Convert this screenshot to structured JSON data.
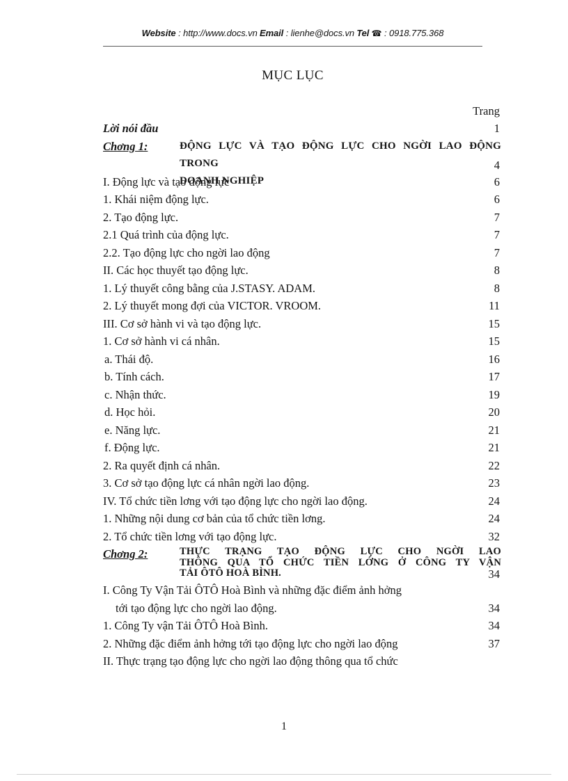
{
  "header": {
    "website_label": "Website",
    "website_sep": " : ",
    "website_value": "http://www.docs.vn",
    "email_label": "Email",
    "email_sep": "  : ",
    "email_value": "lienhe@docs.vn",
    "tel_label": "Tel",
    "tel_glyph": "☎",
    "tel_sep": " : ",
    "tel_value": "0918.775.368"
  },
  "title": "MỤC LỤC",
  "column_header": {
    "label": "",
    "page_label": "Trang"
  },
  "entries": [
    {
      "kind": "front",
      "label": "Lời nói đầu",
      "page": "1"
    },
    {
      "kind": "chapter",
      "tag": "Chơng  1:",
      "lines": [
        "ĐỘNG LỰC VÀ TẠO ĐỘNG LỰC CHO NGỜI    LAO ĐỘNG TRONG",
        "DOANH NGHIỆP"
      ],
      "page": "4"
    },
    {
      "kind": "item",
      "label": "I.  Động lực và tạo động lực",
      "page": "6"
    },
    {
      "kind": "item",
      "label": "1.  Khái niệm động lực.",
      "page": "6"
    },
    {
      "kind": "item",
      "label": "2. Tạo động lực.",
      "page": "7"
    },
    {
      "kind": "item",
      "label": "2.1 Quá trình của động lực.",
      "page": "7"
    },
    {
      "kind": "item",
      "label": "2.2. Tạo động lực cho ngời   lao động",
      "page": "7"
    },
    {
      "kind": "item",
      "label": "II.  Các học thuyết tạo động lực.",
      "page": "8"
    },
    {
      "kind": "item",
      "label": "1.  Lý thuyết công bằng của J.STASY.  ADAM.",
      "page": "8"
    },
    {
      "kind": "item",
      "label": "2.  Lý thuyết mong đợi của VICTOR. VROOM.",
      "page": "11"
    },
    {
      "kind": "item",
      "label": "III. Cơ sở hành vi và tạo động lực.",
      "page": "15"
    },
    {
      "kind": "item",
      "label": "1.  Cơ sở hành vi cá nhân.",
      "page": "15"
    },
    {
      "kind": "item",
      "label": "a.  Thái độ.",
      "page": "16"
    },
    {
      "kind": "item",
      "label": "b. Tính cách.",
      "page": "17"
    },
    {
      "kind": "item",
      "label": "c.  Nhận thức.",
      "page": "19"
    },
    {
      "kind": "item",
      "label": "d.  Học hỏi.",
      "page": "20"
    },
    {
      "kind": "item",
      "label": "e.  Năng lực.",
      "page": "21"
    },
    {
      "kind": "item",
      "label": "f. Động lực.",
      "page": "21"
    },
    {
      "kind": "item",
      "label": "2. Ra quyết định cá nhân.",
      "page": "22"
    },
    {
      "kind": "item",
      "label": "3. Cơ sở tạo động lực cá nhân ngời   lao động.",
      "page": "23"
    },
    {
      "kind": "item",
      "label": "IV. Tổ chức tiền lơng   với tạo động lực cho ngời   lao động.",
      "page": "24"
    },
    {
      "kind": "item",
      "label": "1.  Những nội dung cơ bản của tổ chức tiền lơng.",
      "page": "24"
    },
    {
      "kind": "item",
      "label": "2.  Tổ chức tiền lơng   với tạo động lực.",
      "page": "32"
    },
    {
      "kind": "chapter",
      "tag": "Chơng  2:",
      "lines": [
        "THỰC  TRẠNG  TẠO  ĐỘNG  LỰC  CHO  NGỜI    LAO",
        "THÔNG QUA  TỔ  CHỨC  TIỀN LỚNG    Ở  CÔNG TY VẬN",
        "TẢI ÔTÔ HOÀ BÌNH."
      ],
      "page": "34"
    },
    {
      "kind": "wrap2",
      "line1": "I.  Công Ty Vận Tải ÔTÔ Hoà Bình và những đặc điểm ảnh hởng",
      "line2": "tới tạo động lực cho ngời   lao động.",
      "page": "34"
    },
    {
      "kind": "item",
      "label": "1.  Công Ty vận Tải ÔTÔ Hoà Bình.",
      "page": "34"
    },
    {
      "kind": "item",
      "label": "2.  Những đặc điểm ảnh hởng   tới tạo động lực cho ngời   lao động",
      "page": "37"
    },
    {
      "kind": "item",
      "label": "II. Thực trạng tạo động lực cho ngời   lao động thông qua tổ chức",
      "page": ""
    }
  ],
  "footer": {
    "page_number": "1"
  }
}
